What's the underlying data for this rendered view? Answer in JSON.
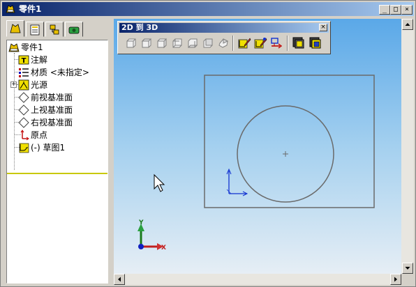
{
  "window": {
    "title": "零件1",
    "minimize": "_",
    "maximize": "□",
    "close": "×"
  },
  "tree": {
    "tabs": [
      {
        "name": "feature-manager-tab-icon"
      },
      {
        "name": "property-manager-tab-icon"
      },
      {
        "name": "configuration-manager-tab-icon"
      },
      {
        "name": "display-manager-tab-icon"
      }
    ],
    "items": [
      {
        "label": "零件1",
        "icon": "part-icon"
      },
      {
        "label": "注解",
        "icon": "annotations-icon"
      },
      {
        "label": "材质 <未指定>",
        "icon": "material-icon"
      },
      {
        "label": "光源",
        "icon": "lights-icon",
        "expand": "+"
      },
      {
        "label": "前视基准面",
        "icon": "plane-icon"
      },
      {
        "label": "上视基准面",
        "icon": "plane-icon"
      },
      {
        "label": "右视基准面",
        "icon": "plane-icon"
      },
      {
        "label": "原点",
        "icon": "origin-icon"
      },
      {
        "label": "(-) 草图1",
        "icon": "sketch-icon"
      }
    ]
  },
  "toolbar_2d3d": {
    "title": "2D 到 3D",
    "close": "×",
    "buttons": [
      "front-view-icon",
      "top-view-icon",
      "right-view-icon",
      "left-view-icon",
      "bottom-view-icon",
      "back-view-icon",
      "auxiliary-view-icon",
      "create-sketch-from-selections-icon",
      "repair-sketch-icon",
      "align-sketch-icon",
      "extrude-icon",
      "cut-icon"
    ]
  },
  "triad": {
    "x_label": "X",
    "y_label": "Y"
  },
  "colors": {
    "viewport_top": "#5aa8e8",
    "viewport_bottom": "#e6eef5",
    "sketch_line": "#6a6a6a",
    "tree_separator": "#c8c800"
  }
}
